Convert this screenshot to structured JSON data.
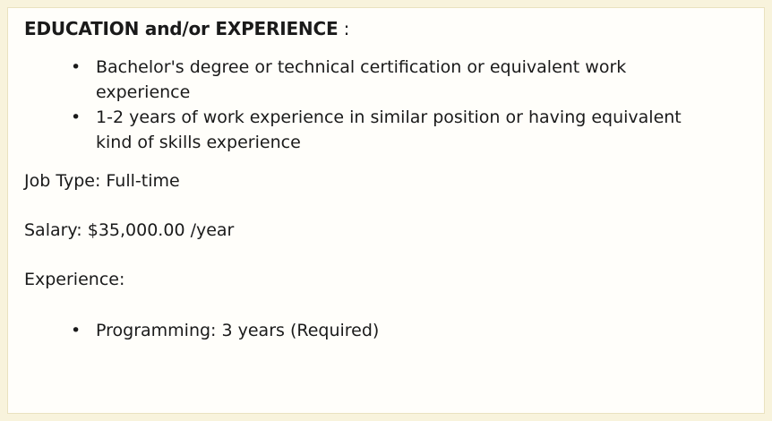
{
  "heading": {
    "title": "EDUCATION and/or EXPERIENCE",
    "colon": " :"
  },
  "education_items": [
    "Bachelor's degree or technical certification or equivalent work experience",
    "1-2 years of work experience in similar position or having equivalent kind of skills experience"
  ],
  "job_type": "Job Type: Full-time",
  "salary": "Salary: $35,000.00 /year",
  "experience_label": "Experience:",
  "experience_items": [
    "Programming: 3 years (Required)"
  ]
}
